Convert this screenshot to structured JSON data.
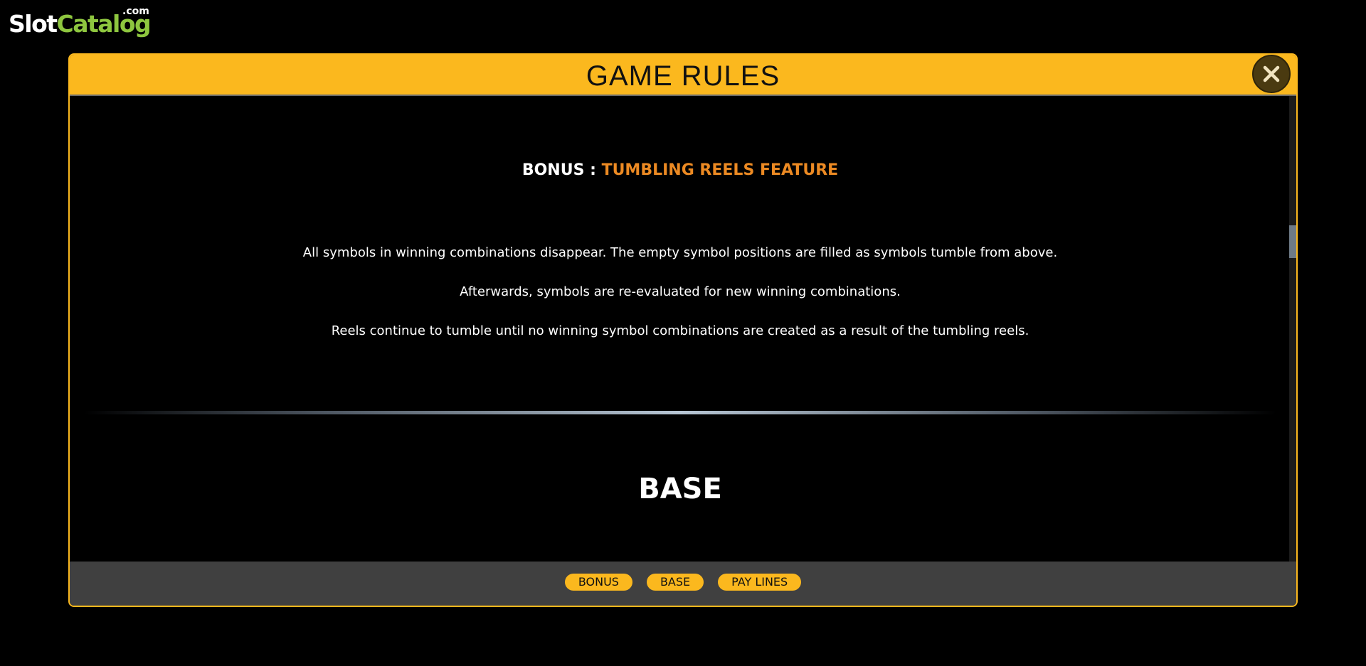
{
  "logo": {
    "slot": "Slot",
    "catalog": "Catalog",
    "com": ".com"
  },
  "modal": {
    "title": "GAME RULES",
    "close_icon": "close-icon"
  },
  "section": {
    "prefix": "BONUS :",
    "feature": "TUMBLING REELS FEATURE",
    "paragraphs": [
      "All symbols in winning combinations disappear. The empty symbol positions are filled as symbols tumble from above.",
      "Afterwards, symbols are re-evaluated for new winning combinations.",
      "Reels continue to tumble until no winning symbol combinations are created as a result of the tumbling reels."
    ]
  },
  "base_section": {
    "title": "BASE"
  },
  "footer_nav": [
    {
      "label": "BONUS"
    },
    {
      "label": "BASE"
    },
    {
      "label": "PAY LINES"
    }
  ],
  "colors": {
    "accent": "#fbb81e",
    "feature": "#ec8a23",
    "logo_green": "#8ec63f",
    "footer_bg": "#404040"
  }
}
